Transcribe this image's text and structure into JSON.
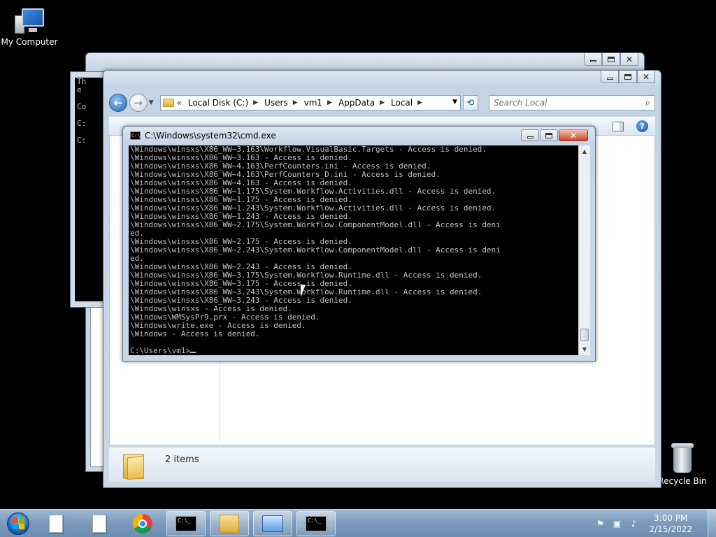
{
  "desktop": {
    "my_computer_label": "My Computer",
    "recycle_bin_label": "Recycle Bin"
  },
  "back_cmd": {
    "lines": [
      "Th",
      "e",
      "",
      "Co",
      "",
      "C:",
      "",
      "C:"
    ]
  },
  "explorer": {
    "address": {
      "overflow": "«",
      "crumbs": [
        "Local Disk (C:)",
        "Users",
        "vm1",
        "AppData",
        "Local"
      ]
    },
    "search_placeholder": "Search Local",
    "status_count": "2 items"
  },
  "cmd": {
    "title": "C:\\Windows\\system32\\cmd.exe",
    "lines": [
      "\\Windows\\winsxs\\X86_WW~3.163\\Workflow.VisualBasic.Targets - Access is denied.",
      "\\Windows\\winsxs\\X86_WW~3.163 - Access is denied.",
      "\\Windows\\winsxs\\X86_WW~4.163\\PerfCounters.ini - Access is denied.",
      "\\Windows\\winsxs\\X86_WW~4.163\\PerfCounters_D.ini - Access is denied.",
      "\\Windows\\winsxs\\X86_WW~4.163 - Access is denied.",
      "\\Windows\\winsxs\\X86_WW~1.175\\System.Workflow.Activities.dll - Access is denied.",
      "\\Windows\\winsxs\\X86_WW~1.175 - Access is denied.",
      "\\Windows\\winsxs\\X86_WW~1.243\\System.Workflow.Activities.dll - Access is denied.",
      "\\Windows\\winsxs\\X86_WW~1.243 - Access is denied.",
      "\\Windows\\winsxs\\X86_WW~2.175\\System.Workflow.ComponentModel.dll - Access is deni",
      "ed.",
      "\\Windows\\winsxs\\X86_WW~2.175 - Access is denied.",
      "\\Windows\\winsxs\\X86_WW~2.243\\System.Workflow.ComponentModel.dll - Access is deni",
      "ed.",
      "\\Windows\\winsxs\\X86_WW~2.243 - Access is denied.",
      "\\Windows\\winsxs\\X86_WW~3.175\\System.Workflow.Runtime.dll - Access is denied.",
      "\\Windows\\winsxs\\X86_WW~3.175 - Access is denied.",
      "\\Windows\\winsxs\\X86_WW~3.243\\System.Workflow.Runtime.dll - Access is denied.",
      "\\Windows\\winsxs\\X86_WW~3.243 - Access is denied.",
      "\\Windows\\winsxs - Access is denied.",
      "\\Windows\\WMSysPr9.prx - Access is denied.",
      "\\Windows\\write.exe - Access is denied.",
      "\\Windows - Access is denied.",
      ""
    ],
    "prompt": "C:\\Users\\vm1>"
  },
  "taskbar": {
    "time": "3:00 PM",
    "date": "2/15/2022"
  },
  "icons": {
    "start": "windows-orb-icon",
    "back": "back-arrow-icon",
    "forward": "forward-arrow-icon",
    "refresh": "refresh-icon",
    "search": "search-icon",
    "help": "help-icon"
  },
  "colors": {
    "desktop": "#000000",
    "console_bg": "#000000",
    "console_fg": "#c0c0c0",
    "close_button": "#c9462c"
  }
}
